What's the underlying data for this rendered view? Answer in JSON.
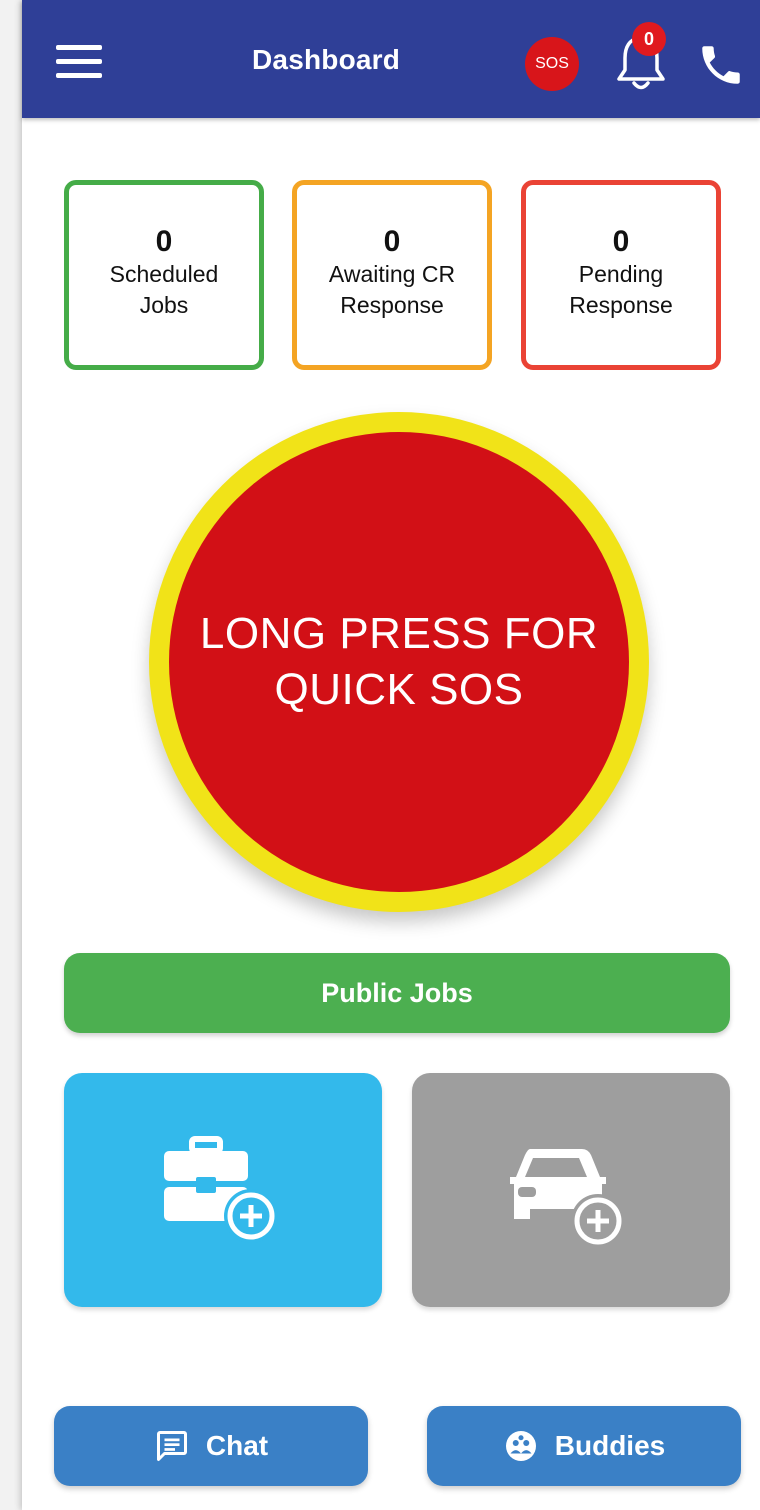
{
  "appbar": {
    "title": "Dashboard",
    "sos_label": "SOS",
    "notification_count": "0"
  },
  "stats": [
    {
      "value": "0",
      "label_line1": "Scheduled",
      "label_line2": "Jobs",
      "color": "#45ac48"
    },
    {
      "value": "0",
      "label_line1": "Awaiting CR",
      "label_line2": "Response",
      "color": "#f4a423"
    },
    {
      "value": "0",
      "label_line1": "Pending",
      "label_line2": "Response",
      "color": "#ea4335"
    }
  ],
  "sos_button": {
    "line1": "LONG PRESS FOR",
    "line2": "QUICK SOS"
  },
  "public_jobs_label": "Public Jobs",
  "tiles": [
    {
      "icon": "add-job-briefcase-icon"
    },
    {
      "icon": "add-vehicle-car-icon"
    }
  ],
  "bottom": {
    "chat_label": "Chat",
    "buddies_label": "Buddies"
  }
}
